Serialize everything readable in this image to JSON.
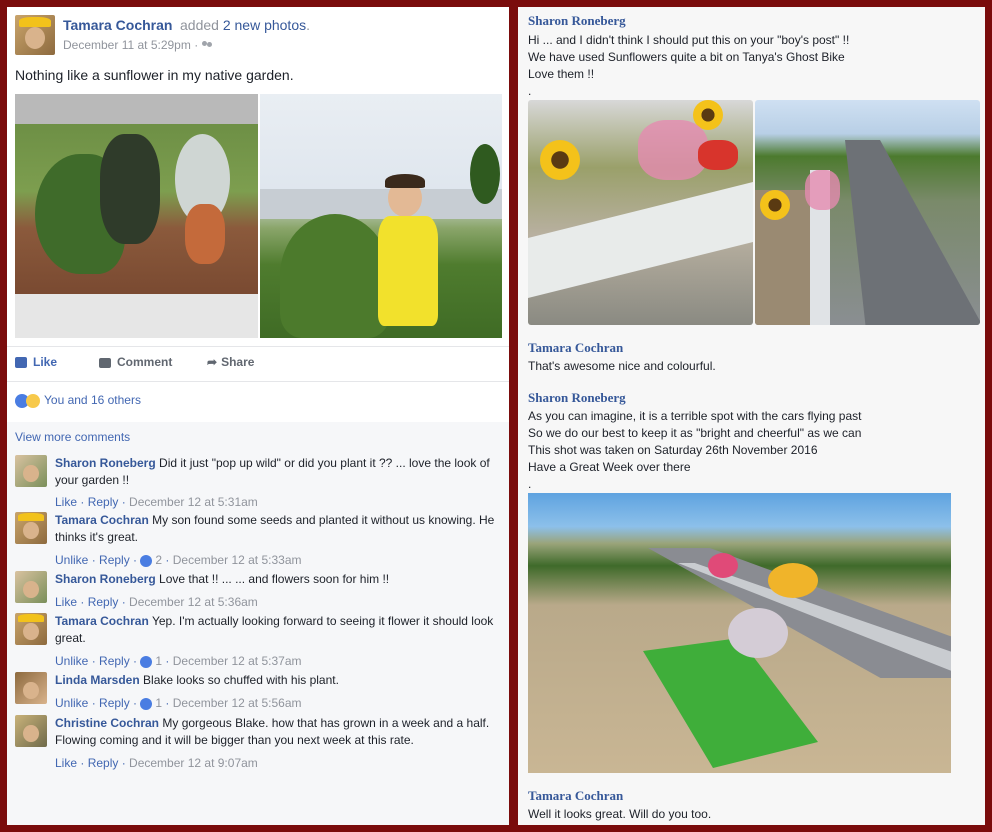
{
  "colors": {
    "frame": "#7a0c0c",
    "link": "#365899",
    "accent": "#4267b2"
  },
  "post": {
    "author": "Tamara Cochran",
    "action_prefix": "added",
    "action_link": "2 new photos",
    "action_suffix": ".",
    "time": "December 11 at 5:29pm",
    "text": "Nothing like a sunflower in my native garden.",
    "like_label": "Like",
    "comment_label": "Comment",
    "share_label": "Share",
    "reactions_text": "You and 16 others",
    "view_more": "View more comments"
  },
  "comments": [
    {
      "name": "Sharon Roneberg",
      "text": "Did it just \"pop up wild\" or did you plant it ?? ... love the look of your garden !!",
      "action": "Like",
      "reply": "Reply",
      "likes": "",
      "time": "December 12 at 5:31am"
    },
    {
      "name": "Tamara Cochran",
      "text": "My son found some seeds and planted it without us knowing. He thinks it's great.",
      "action": "Unlike",
      "reply": "Reply",
      "likes": "2",
      "time": "December 12 at 5:33am"
    },
    {
      "name": "Sharon Roneberg",
      "text": "Love that !! ... ... and flowers soon for him !!",
      "action": "Like",
      "reply": "Reply",
      "likes": "",
      "time": "December 12 at 5:36am"
    },
    {
      "name": "Tamara Cochran",
      "text": "Yep. I'm actually looking forward to seeing it flower it should look great.",
      "action": "Unlike",
      "reply": "Reply",
      "likes": "1",
      "time": "December 12 at 5:37am"
    },
    {
      "name": "Linda Marsden",
      "text": "Blake looks so chuffed with his plant.",
      "action": "Unlike",
      "reply": "Reply",
      "likes": "1",
      "time": "December 12 at 5:56am"
    },
    {
      "name": "Christine Cochran",
      "text": "My gorgeous Blake. how that has grown in a week and a half. Flowing coming and it will be bigger than you next week at this rate.",
      "action": "Like",
      "reply": "Reply",
      "likes": "",
      "time": "December 12 at 9:07am"
    }
  ],
  "right": {
    "msg1_name": "Sharon Roneberg",
    "msg1_lines": [
      "Hi ... and I didn't think I should put this on your \"boy's post\" !!",
      "We have used Sunflowers quite a bit on Tanya's Ghost Bike",
      "Love them !!",
      "."
    ],
    "msg2_name": "Tamara Cochran",
    "msg2_lines": [
      "That's awesome nice and colourful."
    ],
    "msg3_name": "Sharon Roneberg",
    "msg3_lines": [
      "As you can imagine, it is a terrible spot with the cars flying past",
      "So we do our best to keep it as \"bright and cheerful\" as we can",
      "This shot was taken on Saturday 26th November 2016",
      "Have a Great Week over there",
      "."
    ],
    "msg4_name": "Tamara Cochran",
    "msg4_lines": [
      "Well it looks great. Will do you too."
    ]
  }
}
